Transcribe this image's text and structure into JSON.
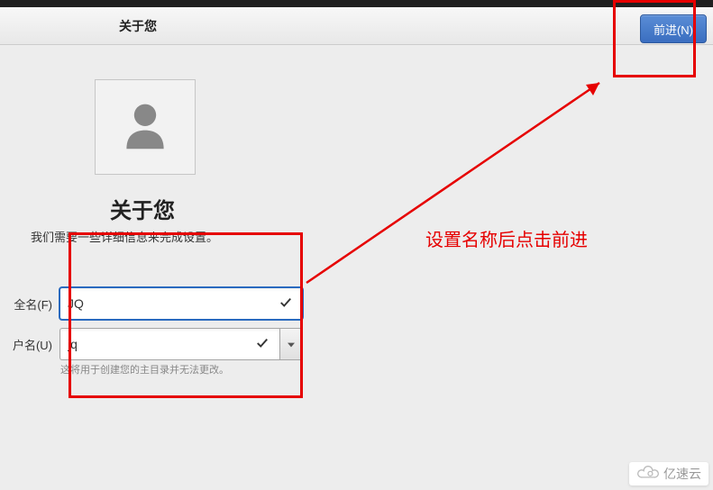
{
  "titlebar": {
    "title": "关于您",
    "forward_btn": "前进(N)"
  },
  "page": {
    "heading": "关于您",
    "subheading": "我们需要一些详细信息来完成设置。"
  },
  "form": {
    "fullname_label": "全名(F)",
    "fullname_value": "JQ",
    "username_label": "户名(U)",
    "username_value": "jq",
    "username_hint": "这将用于创建您的主目录并无法更改。"
  },
  "annotation": {
    "text": "设置名称后点击前进"
  },
  "watermark": {
    "text": "亿速云"
  }
}
